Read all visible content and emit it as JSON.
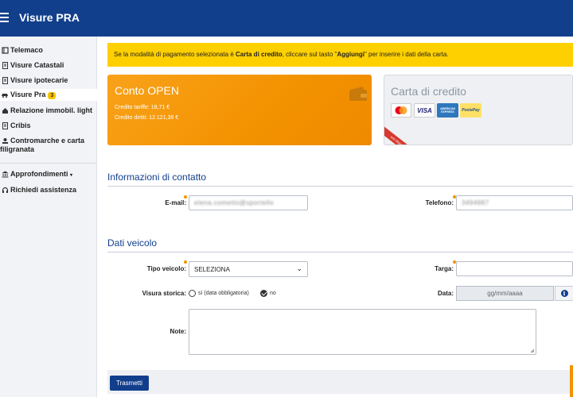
{
  "app": {
    "title": "Visure PRA"
  },
  "sidebar": {
    "items": [
      {
        "label": "Telemaco",
        "icon": "book-icon"
      },
      {
        "label": "Visure Catastali",
        "icon": "document-icon"
      },
      {
        "label": "Visure ipotecarie",
        "icon": "document-icon"
      },
      {
        "label": "Visure Pra",
        "icon": "car-icon",
        "badge": "3"
      },
      {
        "label": "Relazione immobil. light",
        "icon": "house-icon"
      },
      {
        "label": "Cribis",
        "icon": "document-icon"
      },
      {
        "label": "Contromarche e carta",
        "label2": "filigranata",
        "icon": "stamp-icon"
      },
      {
        "label": "Approfondimenti",
        "icon": "bank-icon"
      },
      {
        "label": "Richiedi assistenza",
        "icon": "headset-icon"
      }
    ]
  },
  "notice": {
    "pre": "Se la modalità di pagamento selezionata è ",
    "bold1": "Carta di credito",
    "mid": ", cliccare sul tasto \"",
    "bold2": "Aggiungi",
    "post": "\" per inserire i dati della carta."
  },
  "payment": {
    "open": {
      "title": "Conto OPEN",
      "line1": "Credito tariffe: 18,71 €",
      "line2": "Credito diritti: 12.121,38 €"
    },
    "cc": {
      "title": "Carta di credito",
      "logos": [
        "Mastercard",
        "VISA",
        "AMERICAN EXPRESS",
        "PostePay"
      ],
      "ribbon": "non disponibile"
    }
  },
  "contact": {
    "title": "Informazioni di contatto",
    "email_label": "E-mail:",
    "email_value": "elena.cometto@sportello",
    "phone_label": "Telefono:",
    "phone_value": "3494987"
  },
  "vehicle": {
    "title": "Dati veicolo",
    "type_label": "Tipo veicolo:",
    "type_value": "SELEZIONA",
    "plate_label": "Targa:",
    "historic_label": "Visura storica:",
    "opt_yes": "sì (data obbligatoria)",
    "opt_no": "no",
    "date_label": "Data:",
    "date_placeholder": "gg/mm/aaaa",
    "notes_label": "Note:"
  },
  "actions": {
    "submit": "Trasmetti"
  },
  "colors": {
    "brand": "#123f8c",
    "accent": "#f39200",
    "notice": "#ffd000"
  }
}
